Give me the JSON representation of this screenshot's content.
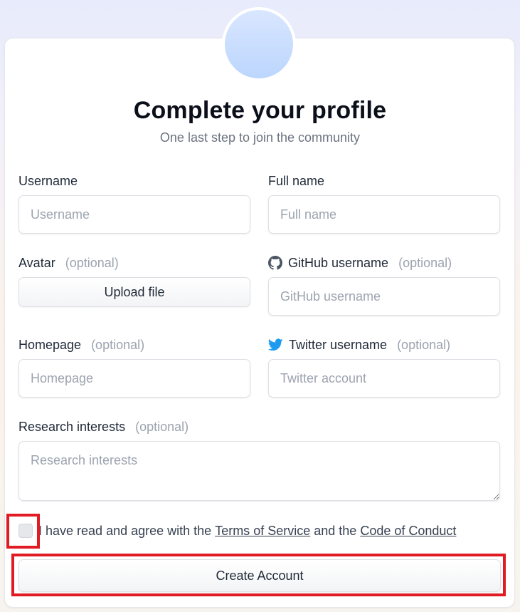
{
  "header": {
    "title": "Complete your profile",
    "subtitle": "One last step to join the community"
  },
  "fields": {
    "username": {
      "label": "Username",
      "placeholder": "Username"
    },
    "fullname": {
      "label": "Full name",
      "placeholder": "Full name"
    },
    "avatar": {
      "label": "Avatar",
      "optional": "(optional)",
      "button": "Upload file"
    },
    "github": {
      "label": "GitHub username",
      "optional": "(optional)",
      "placeholder": "GitHub username"
    },
    "homepage": {
      "label": "Homepage",
      "optional": "(optional)",
      "placeholder": "Homepage"
    },
    "twitter": {
      "label": "Twitter username",
      "optional": "(optional)",
      "placeholder": "Twitter account"
    },
    "research": {
      "label": "Research interests",
      "optional": "(optional)",
      "placeholder": "Research interests"
    }
  },
  "agreement": {
    "prefix": "I have read and agree with the",
    "terms_link": "Terms of Service",
    "middle": "and the",
    "conduct_link": "Code of Conduct"
  },
  "submit": {
    "label": "Create Account"
  },
  "icons": {
    "github": "github-icon",
    "twitter": "twitter-bird-icon"
  },
  "colors": {
    "highlight": "#e01b24",
    "twitter": "#1d9bf0",
    "github": "#4b5563"
  }
}
